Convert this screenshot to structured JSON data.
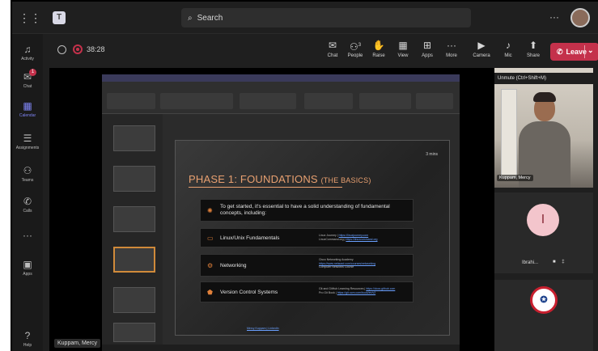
{
  "topbar": {
    "search_placeholder": "Search",
    "more_label": "···"
  },
  "rail": [
    {
      "label": "Activity",
      "icon": "bell-icon"
    },
    {
      "label": "Chat",
      "icon": "chat-icon",
      "badge": "1"
    },
    {
      "label": "Calendar",
      "icon": "calendar-icon",
      "active": true
    },
    {
      "label": "Assignments",
      "icon": "assignments-icon"
    },
    {
      "label": "Teams",
      "icon": "teams-icon"
    },
    {
      "label": "Calls",
      "icon": "phone-icon"
    },
    {
      "label": "···",
      "icon": "more-icon"
    },
    {
      "label": "Apps",
      "icon": "apps-icon"
    },
    {
      "label": "Help",
      "icon": "help-icon"
    }
  ],
  "meeting": {
    "timer": "38:28",
    "controls": [
      {
        "label": "Chat",
        "icon": "chat-icon"
      },
      {
        "label": "People",
        "icon": "people-icon",
        "count": "3"
      },
      {
        "label": "Raise",
        "icon": "hand-icon"
      },
      {
        "label": "View",
        "icon": "view-icon"
      },
      {
        "label": "Apps",
        "icon": "add-app-icon"
      },
      {
        "label": "More",
        "icon": "more-icon"
      },
      {
        "label": "Camera",
        "icon": "camera-off-icon"
      },
      {
        "label": "Mic",
        "icon": "mic-off-icon"
      },
      {
        "label": "Share",
        "icon": "share-icon"
      }
    ],
    "leave_label": "Leave"
  },
  "slide": {
    "time_label": "3 mins",
    "title_main": "PHASE 1: FOUNDATIONS ",
    "title_small": "(THE BASICS)",
    "intro": "To get started, it's essential to have a solid understanding of fundamental concepts, including:",
    "items": [
      {
        "label": "Linux/Unix Fundamentals",
        "icon": "terminal-icon"
      },
      {
        "label": "Networking",
        "icon": "network-icon"
      },
      {
        "label": "Version Control Systems",
        "icon": "git-icon"
      }
    ],
    "credit": "Mercy Kuppam | LinkedIn"
  },
  "presenter_name": "Kuppam, Mercy",
  "participants": {
    "tooltip": "Unmute (Ctrl+Shift+M)",
    "video_name": "Kuppam, Mercy",
    "avatar_initial": "I",
    "avatar_name": "Ibrahi...",
    "avatar_status": "■ ‡"
  },
  "colors": {
    "leave": "#c4314b",
    "accent": "#7f85f5",
    "slide_title": "#e8a070"
  }
}
